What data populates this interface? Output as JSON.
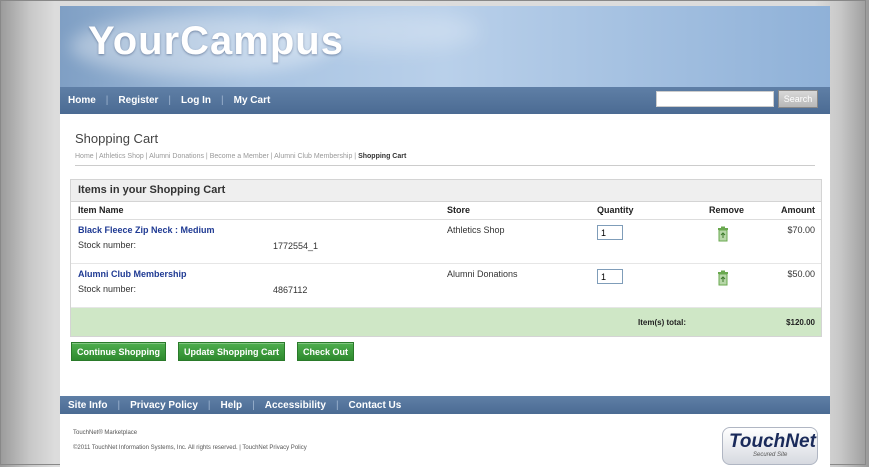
{
  "brand": "YourCampus",
  "nav": {
    "items": [
      "Home",
      "Register",
      "Log In",
      "My Cart"
    ],
    "search_placeholder": "",
    "search_button": "Search"
  },
  "page": {
    "title": "Shopping Cart",
    "breadcrumbs": [
      "Home",
      "Athletics Shop",
      "Alumni Donations",
      "Become a Member",
      "Alumni Club Membership"
    ],
    "breadcrumb_current": "Shopping Cart"
  },
  "cart": {
    "heading": "Items in your Shopping Cart",
    "columns": {
      "item": "Item Name",
      "store": "Store",
      "qty": "Quantity",
      "remove": "Remove",
      "amount": "Amount"
    },
    "items": [
      {
        "name": "Black Fleece Zip Neck : Medium",
        "stock_label": "Stock number:",
        "stock": "1772554_1",
        "store": "Athletics Shop",
        "qty": "1",
        "amount": "$70.00"
      },
      {
        "name": "Alumni Club Membership",
        "stock_label": "Stock number:",
        "stock": "4867112",
        "store": "Alumni Donations",
        "qty": "1",
        "amount": "$50.00"
      }
    ],
    "total_label": "Item(s) total:",
    "total_value": "$120.00"
  },
  "actions": {
    "continue": "Continue Shopping",
    "update": "Update Shopping Cart",
    "checkout": "Check Out"
  },
  "footer": {
    "links": [
      "Site Info",
      "Privacy Policy",
      "Help",
      "Accessibility",
      "Contact Us"
    ],
    "touchnet": "TouchNet® Marketplace",
    "copyright": "©2011 TouchNet Information Systems, Inc. All rights reserved. | TouchNet Privacy Policy",
    "logo_main": "TouchNet",
    "logo_sub": "Secured Site"
  },
  "colors": {
    "nav": "#4b6b93",
    "button_green": "#3a9a3a",
    "total_bg": "#cfe7c6",
    "link": "#1f3a93"
  }
}
